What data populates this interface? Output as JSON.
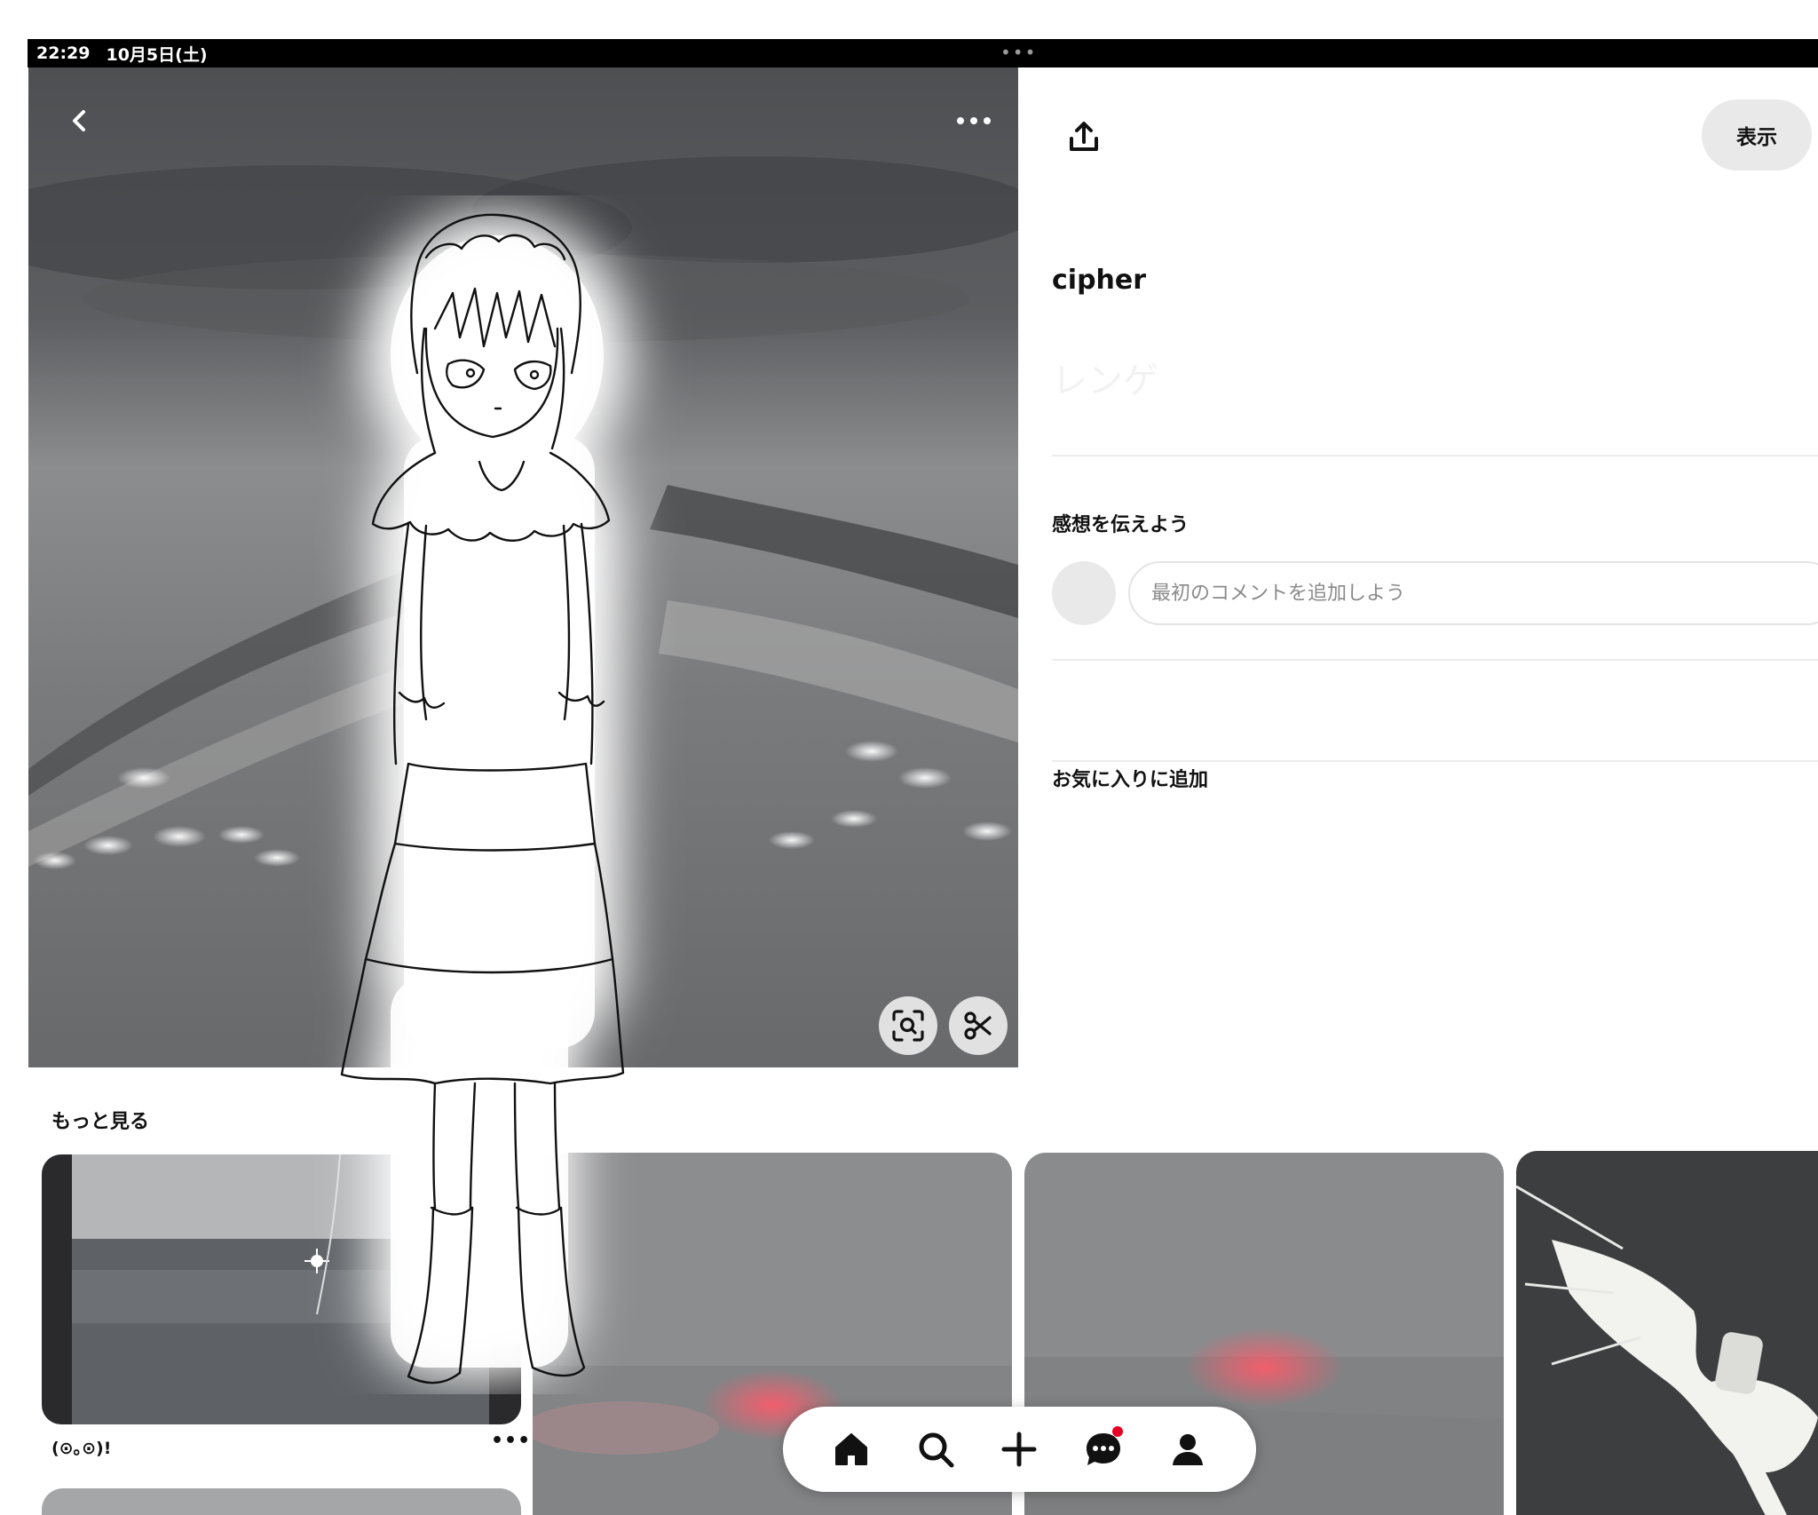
{
  "status_bar": {
    "time": "22:29",
    "date": "10月5日(土)"
  },
  "pin": {
    "title": "cipher",
    "faint_text": "レンゲ",
    "back_icon": "chevron-left-icon",
    "more_icon": "ellipsis-icon",
    "visual_search_icon": "visual-search-icon",
    "crop_icon": "scissors-icon"
  },
  "panel": {
    "share_icon": "share-upload-icon",
    "view_label": "表示",
    "comments_heading": "感想を伝えよう",
    "comment_placeholder": "最初のコメントを追加しよう",
    "add_to_favorites": "お気に入りに追加"
  },
  "more_section": {
    "heading": "もっと見る",
    "tiles": [
      {
        "caption": "(⊙｡⊙)!",
        "more_label": "•••"
      },
      {
        "caption": ""
      },
      {
        "caption": ""
      },
      {
        "caption": ""
      },
      {
        "caption": ""
      }
    ]
  },
  "bottom_nav": {
    "items": [
      {
        "icon": "home-icon"
      },
      {
        "icon": "search-icon"
      },
      {
        "icon": "plus-icon"
      },
      {
        "icon": "messages-icon",
        "badge": true
      },
      {
        "icon": "profile-icon"
      }
    ]
  },
  "colors": {
    "accent_red": "#e60023",
    "button_gray": "#e9e9e9",
    "status_bar": "#000000"
  }
}
